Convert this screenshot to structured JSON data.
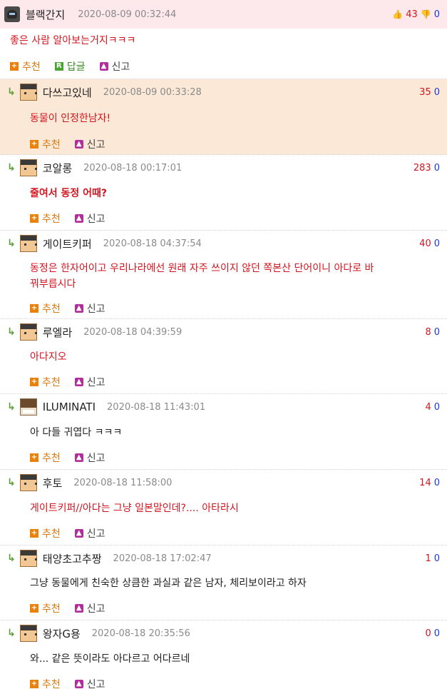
{
  "top_comment": {
    "nick": "블랙간지",
    "date": "2020-08-09 00:32:44",
    "up": "43",
    "down": "0",
    "text": "좋은 사람 알아보는거지ㅋㅋㅋ",
    "actions": {
      "recommend": "추천",
      "reply": "답글",
      "report": "신고"
    }
  },
  "replies": [
    {
      "nick": "다쓰고있네",
      "date": "2020-08-09 00:33:28",
      "up": "35",
      "down": "0",
      "text": "동물이 인정한남자!",
      "recommend": "추천",
      "report": "신고"
    },
    {
      "nick": "코알롱",
      "date": "2020-08-18 00:17:01",
      "up": "283",
      "down": "0",
      "text": "줄여서 동정 어때?",
      "recommend": "추천",
      "report": "신고"
    },
    {
      "nick": "게이트키퍼",
      "date": "2020-08-18 04:37:54",
      "up": "40",
      "down": "0",
      "text_line1": "동정은 한자어이고 우리나라에선 원래 자주 쓰이지 않던 쪽본산 단어이니 아다로 바",
      "text_line2": "꿔부릅시다",
      "recommend": "추천",
      "report": "신고"
    },
    {
      "nick": "루엘라",
      "date": "2020-08-18 04:39:59",
      "up": "8",
      "down": "0",
      "text": "아다지오",
      "recommend": "추천",
      "report": "신고"
    },
    {
      "nick": "ILUMINATI",
      "date": "2020-08-18 11:43:01",
      "up": "4",
      "down": "0",
      "text": "아 다들 귀엽다 ㅋㅋㅋ",
      "recommend": "추천",
      "report": "신고"
    },
    {
      "nick": "후토",
      "date": "2020-08-18 11:58:00",
      "up": "14",
      "down": "0",
      "text": "게이트키퍼//아다는 그냥 일본말인데?.... 아타라시",
      "recommend": "추천",
      "report": "신고"
    },
    {
      "nick": "태양초고추짱",
      "date": "2020-08-18 17:02:47",
      "up": "1",
      "down": "0",
      "text": "그냥 동물에게 친숙한 상큼한 과실과 같은 남자, 체리보이라고 하자",
      "recommend": "추천",
      "report": "신고"
    },
    {
      "nick": "왕자G용",
      "date": "2020-08-18 20:35:56",
      "up": "0",
      "down": "0",
      "text": "와... 같은 뜻이라도 아다르고 어다르네",
      "recommend": "추천",
      "report": "신고"
    }
  ],
  "icons": {
    "up": "thumbs-up-icon",
    "down": "thumbs-down-icon",
    "arrow": "reply-arrow-icon"
  },
  "colors": {
    "accent_red": "#d2161f",
    "accent_blue": "#1a3ad4",
    "top_bg": "#fde8eb",
    "highlight_bg": "#fbe8d6"
  }
}
